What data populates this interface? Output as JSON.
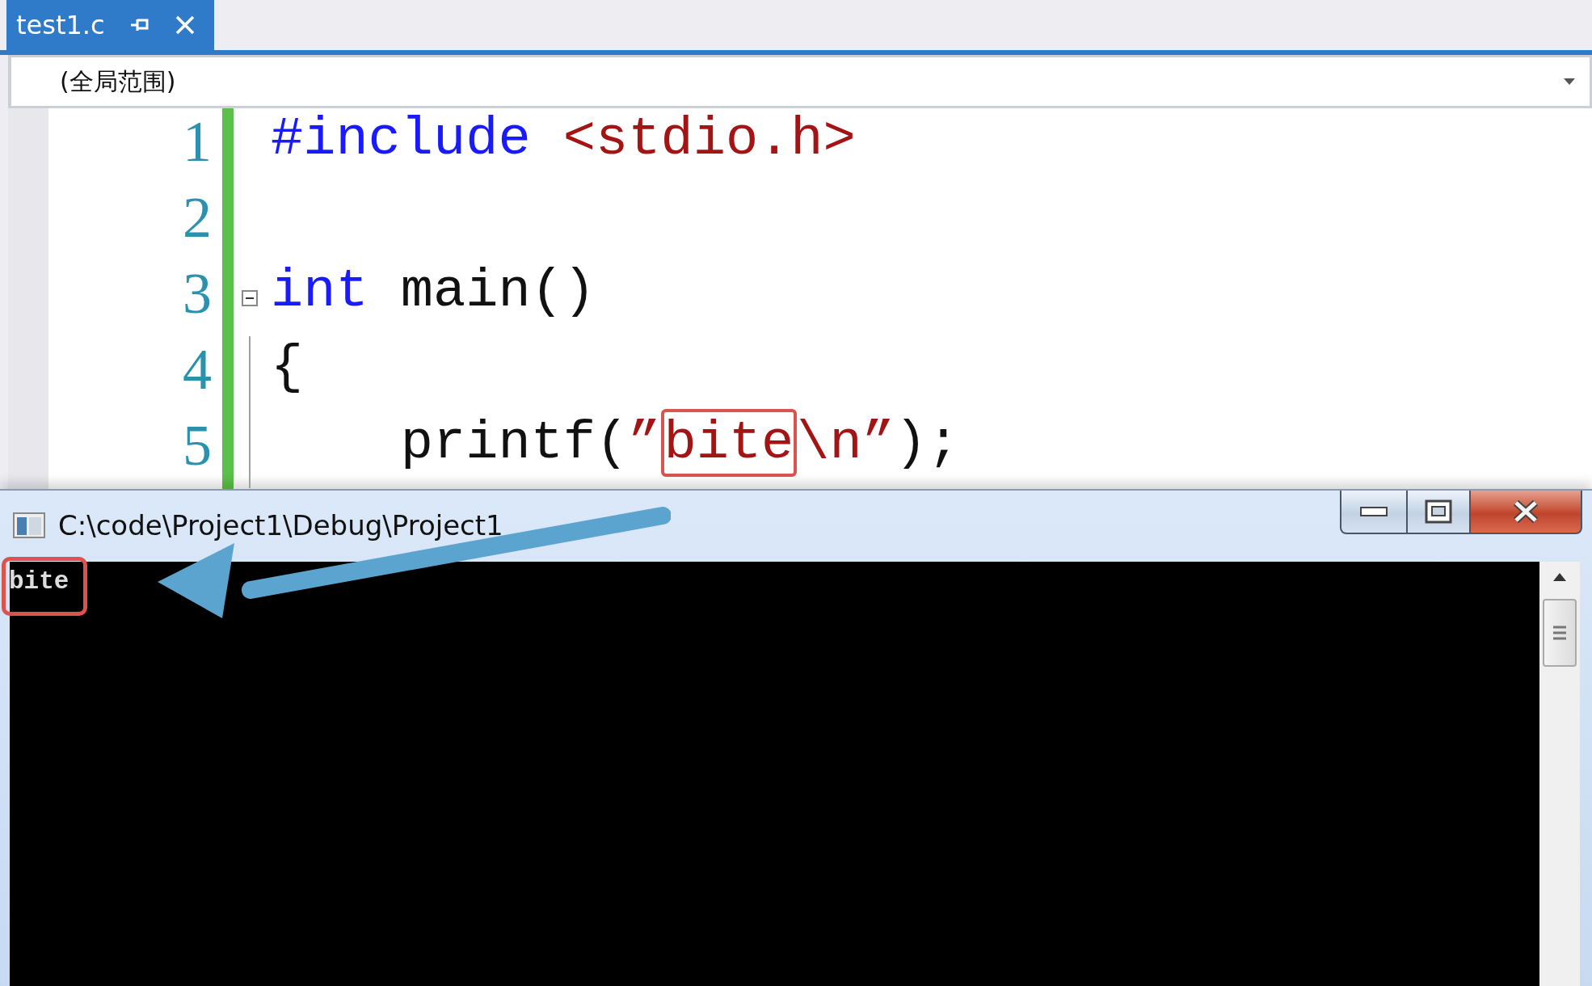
{
  "tab": {
    "title": "test1.c",
    "selected": true
  },
  "scope": {
    "value": "(全局范围)"
  },
  "code_lines": [
    {
      "number": "1",
      "foldable": false,
      "tokens": [
        {
          "kind": "preproc",
          "text": "#include"
        },
        {
          "kind": "string",
          "text": " <stdio.h>"
        }
      ]
    },
    {
      "number": "2",
      "foldable": false
    },
    {
      "number": "3",
      "foldable": true,
      "tokens": [
        {
          "kind": "keyword",
          "text": "int"
        },
        {
          "kind": "plain",
          "text": " main()"
        }
      ]
    },
    {
      "number": "4",
      "foldable": false,
      "tokens": [
        {
          "kind": "plain",
          "text": "{"
        }
      ]
    },
    {
      "number": "5",
      "foldable": false,
      "tokens": [
        {
          "kind": "plain",
          "text": "    printf("
        },
        {
          "kind": "string",
          "text": "”"
        },
        {
          "kind": "string",
          "text": "bite",
          "highlighted": true
        },
        {
          "kind": "string",
          "text": "\\n”"
        },
        {
          "kind": "plain",
          "text": ");"
        }
      ]
    }
  ],
  "console": {
    "title": "C:\\code\\Project1\\Debug\\Project1",
    "output": "bite"
  }
}
